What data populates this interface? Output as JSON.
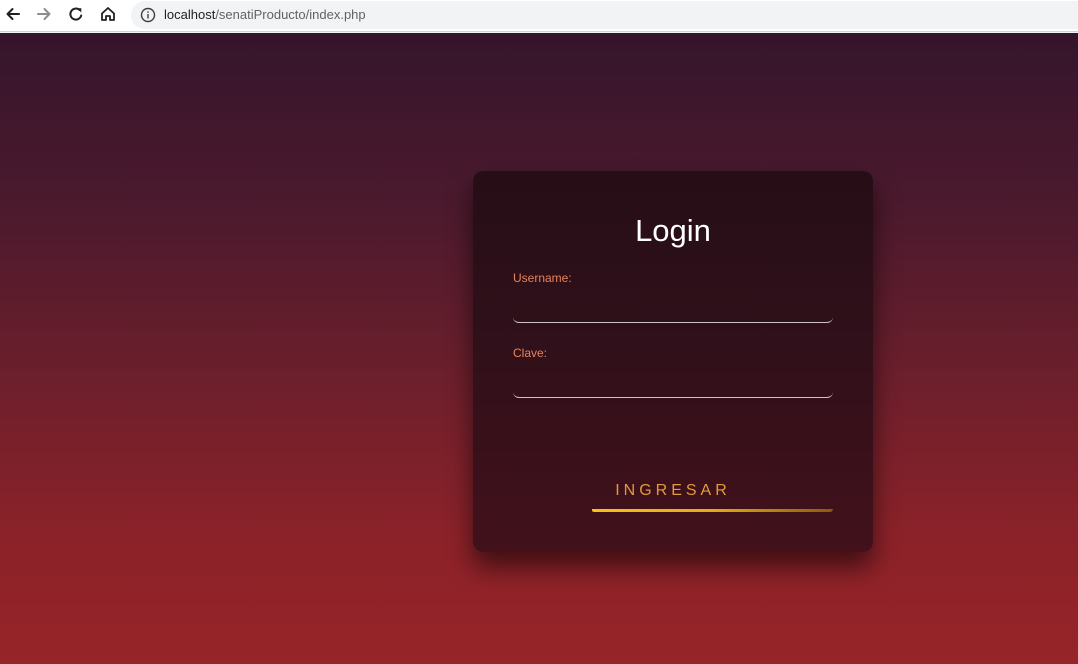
{
  "browser": {
    "url_host": "localhost",
    "url_path": "/senatiProducto/index.php"
  },
  "login": {
    "title": "Login",
    "username_label": "Username:",
    "username_value": "",
    "password_label": "Clave:",
    "password_value": "",
    "submit_label": "INGRESAR"
  },
  "colors": {
    "background_top": "#35152c",
    "background_bottom": "#962428",
    "label": "#e7845a",
    "button_text": "#e39a3a",
    "button_underline": "#f3c419"
  }
}
